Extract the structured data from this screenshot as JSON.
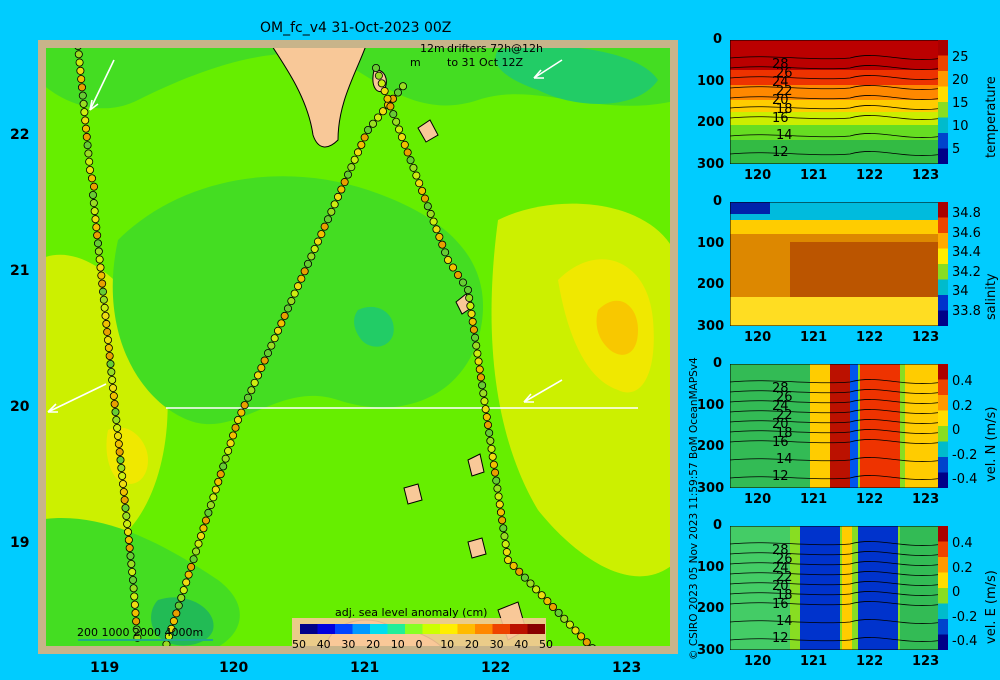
{
  "title": "OM_fc_v4  31-Oct-2023 00Z",
  "map": {
    "lat_ticks": [
      "22",
      "21",
      "20",
      "19"
    ],
    "lon_ticks": [
      "119",
      "120",
      "121",
      "122",
      "123"
    ],
    "legend_drifters_line1": "12m",
    "legend_drifters_label1": "drifters 72h@12h",
    "legend_drifters_line2": "m",
    "legend_drifters_label2": "to 31 Oct 12Z",
    "bathymetry_label": "200  1000  2000  4000m",
    "colorbar_title": "adj. sea level anomaly (cm)",
    "colorbar_ticks": [
      "50",
      "40",
      "30",
      "20",
      "10",
      "0",
      "10",
      "20",
      "30",
      "40",
      "50"
    ]
  },
  "credit": "© CSIRO 2023   05 Nov 2023 11:59:57 BoM OceanMAPSv4",
  "sections": [
    {
      "name": "temperature-panel",
      "y_ticks": [
        "0",
        "100",
        "200",
        "300"
      ],
      "x_ticks": [
        "120",
        "121",
        "122",
        "123"
      ],
      "colorbar_label": "temperature",
      "colorbar_ticks": [
        "25",
        "20",
        "15",
        "10",
        "5"
      ],
      "contour_labels": [
        "28",
        "26",
        "24",
        "22",
        "20",
        "18",
        "16",
        "14",
        "12"
      ]
    },
    {
      "name": "salinity-panel",
      "y_ticks": [
        "0",
        "100",
        "200",
        "300"
      ],
      "x_ticks": [
        "120",
        "121",
        "122",
        "123"
      ],
      "colorbar_label": "salinity",
      "colorbar_ticks": [
        "34.8",
        "34.6",
        "34.4",
        "34.2",
        "34",
        "33.8"
      ]
    },
    {
      "name": "vel-n-panel",
      "y_ticks": [
        "0",
        "100",
        "200",
        "300"
      ],
      "x_ticks": [
        "120",
        "121",
        "122",
        "123"
      ],
      "colorbar_label": "vel. N (m/s)",
      "colorbar_ticks": [
        "0.4",
        "0.2",
        "0",
        "-0.2",
        "-0.4"
      ],
      "contour_labels": [
        "28",
        "26",
        "24",
        "22",
        "20",
        "18",
        "16",
        "14",
        "12"
      ]
    },
    {
      "name": "vel-e-panel",
      "y_ticks": [
        "0",
        "100",
        "200",
        "300"
      ],
      "x_ticks": [
        "120",
        "121",
        "122",
        "123"
      ],
      "colorbar_label": "vel. E (m/s)",
      "colorbar_ticks": [
        "0.4",
        "0.2",
        "0",
        "-0.2",
        "-0.4"
      ],
      "contour_labels": [
        "28",
        "26",
        "24",
        "22",
        "20",
        "18",
        "16",
        "14",
        "12"
      ]
    }
  ],
  "colors": {
    "background": "#00ccff",
    "sea_base": "#66ee00",
    "land": "#f8c898",
    "frame": "#c8b48a"
  }
}
